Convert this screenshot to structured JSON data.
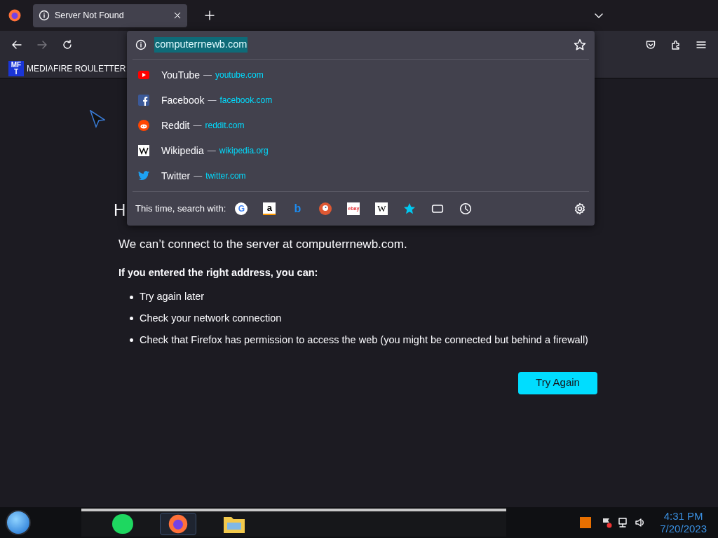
{
  "tab": {
    "title": "Server Not Found",
    "selected": true
  },
  "bookmarks": [
    {
      "badge_top": "MF",
      "badge_bottom": "T",
      "label": "MEDIAFIRE ROULETTER"
    }
  ],
  "urlbar": {
    "value": "computerrnewb.com",
    "selected_text": true
  },
  "suggestions": [
    {
      "kind": "youtube",
      "title": "YouTube",
      "sep": "—",
      "url": "youtube.com"
    },
    {
      "kind": "facebook",
      "title": "Facebook",
      "sep": "—",
      "url": "facebook.com"
    },
    {
      "kind": "reddit",
      "title": "Reddit",
      "sep": "—",
      "url": "reddit.com"
    },
    {
      "kind": "wikipedia",
      "title": "Wikipedia",
      "sep": "—",
      "url": "wikipedia.org"
    },
    {
      "kind": "twitter",
      "title": "Twitter",
      "sep": "—",
      "url": "twitter.com"
    }
  ],
  "search_with": {
    "label": "This time, search with:",
    "engines": [
      {
        "kind": "google",
        "glyph": "G"
      },
      {
        "kind": "amazon",
        "glyph": "a"
      },
      {
        "kind": "bing",
        "glyph": "b"
      },
      {
        "kind": "duckduckgo"
      },
      {
        "kind": "ebay",
        "glyph": "ebay"
      },
      {
        "kind": "wikipedia",
        "glyph": "W"
      },
      {
        "kind": "bookmarks"
      },
      {
        "kind": "tabs"
      },
      {
        "kind": "history"
      }
    ]
  },
  "error_page": {
    "heading": "H",
    "message": "We can’t connect to the server at computerrnewb.com.",
    "subheading": "If you entered the right address, you can:",
    "bullets": [
      "Try again later",
      "Check your network connection",
      "Check that Firefox has permission to access the web (you might be connected but behind a firewall)"
    ],
    "button": "Try Again"
  },
  "taskbar": {
    "time": "4:31 PM",
    "date": "7/20/2023"
  }
}
